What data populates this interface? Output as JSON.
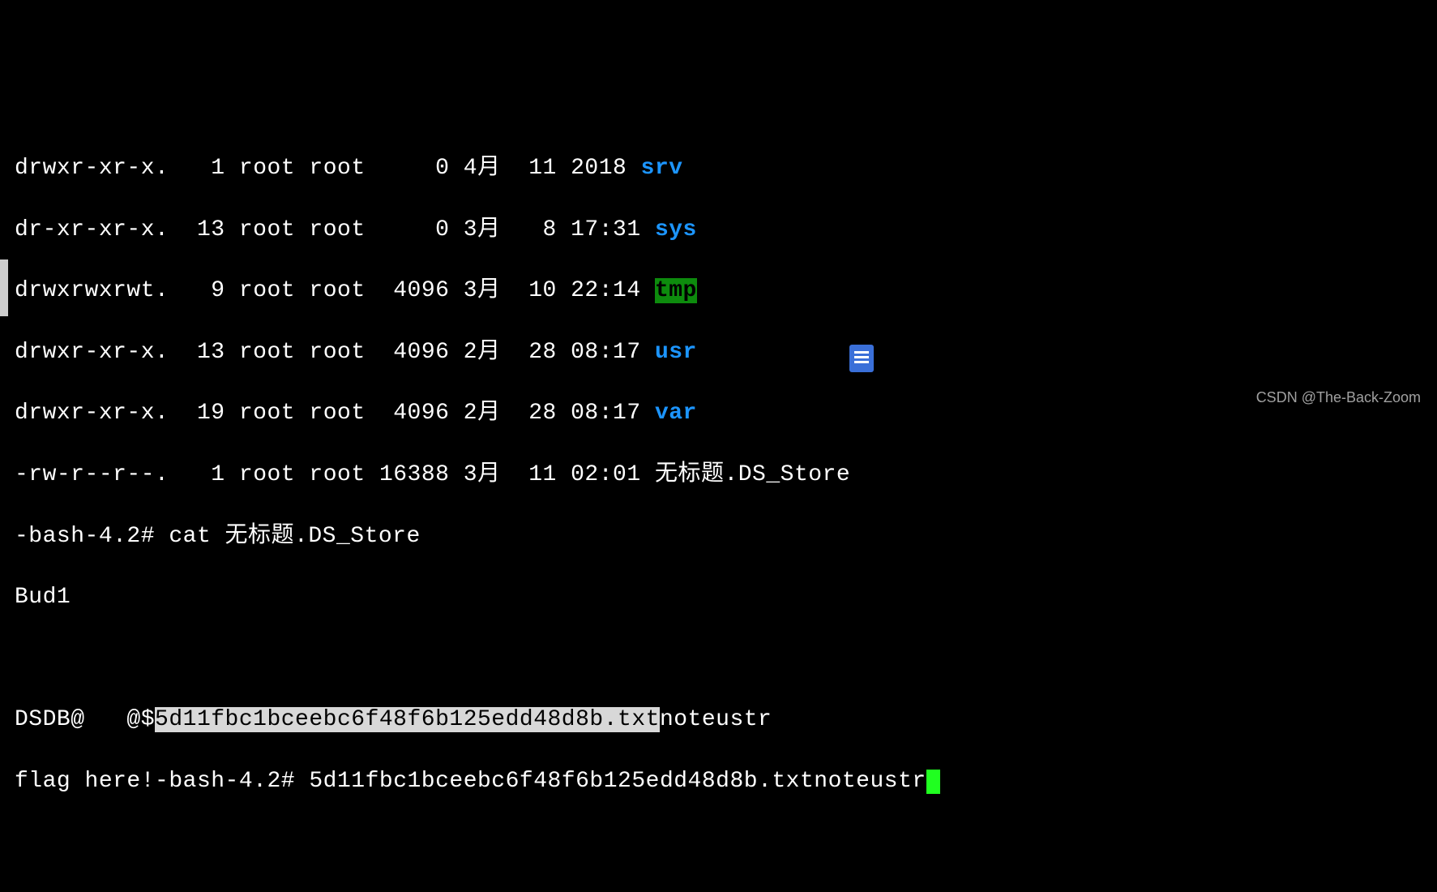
{
  "ls": [
    {
      "perms": "drwxr-xr-x.",
      "links": "1",
      "owner": "root",
      "group": "root",
      "size": "0",
      "month": "4月",
      "day": "11",
      "time": "2018",
      "name": "srv",
      "color": "blue"
    },
    {
      "perms": "dr-xr-xr-x.",
      "links": "13",
      "owner": "root",
      "group": "root",
      "size": "0",
      "month": "3月",
      "day": "8",
      "time": "17:31",
      "name": "sys",
      "color": "blue"
    },
    {
      "perms": "drwxrwxrwt.",
      "links": "9",
      "owner": "root",
      "group": "root",
      "size": "4096",
      "month": "3月",
      "day": "10",
      "time": "22:14",
      "name": "tmp",
      "color": "tmp"
    },
    {
      "perms": "drwxr-xr-x.",
      "links": "13",
      "owner": "root",
      "group": "root",
      "size": "4096",
      "month": "2月",
      "day": "28",
      "time": "08:17",
      "name": "usr",
      "color": "blue"
    },
    {
      "perms": "drwxr-xr-x.",
      "links": "19",
      "owner": "root",
      "group": "root",
      "size": "4096",
      "month": "2月",
      "day": "28",
      "time": "08:17",
      "name": "var",
      "color": "blue"
    },
    {
      "perms": "-rw-r--r--.",
      "links": "1",
      "owner": "root",
      "group": "root",
      "size": "16388",
      "month": "3月",
      "day": "11",
      "time": "02:01",
      "name": "无标题.DS_Store",
      "color": "none"
    }
  ],
  "cat": {
    "prompt": "-bash-4.2# ",
    "cmd": "cat 无标题.DS_Store",
    "out1": "Bud1",
    "blank": "",
    "out2a": "DSDB@   @$",
    "out2b": "5d11fbc1bceebc6f48f6b125edd48d8b.txt",
    "out2c": "noteustr",
    "out3a": "flag here!",
    "out3b": "-bash-4.2# ",
    "out3c": "5d11fbc1bceebc6f48f6b125",
    "out3d": "edd48d8b.txtnoteustr"
  },
  "wm": "CSDN @The-Back-Zoom"
}
